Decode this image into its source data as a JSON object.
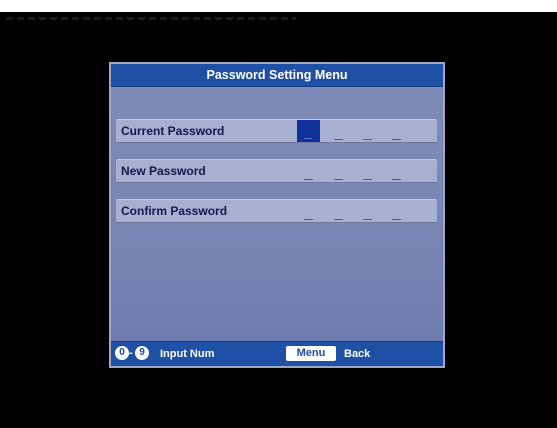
{
  "dialog": {
    "title": "Password Setting Menu",
    "rows": [
      {
        "label": "Current Password",
        "slots": 4,
        "active_slot": 0
      },
      {
        "label": "New Password",
        "slots": 4
      },
      {
        "label": "Confirm Password",
        "slots": 4
      }
    ]
  },
  "footer": {
    "key_start": "0",
    "key_separator": "-",
    "key_end": "9",
    "input_hint": "Input Num",
    "menu_key": "Menu",
    "back_hint": "Back"
  },
  "colors": {
    "title_bar": "#1e50a6",
    "panel": "#7a86b3",
    "row": "#a8b0d2",
    "cursor": "#10309c"
  }
}
